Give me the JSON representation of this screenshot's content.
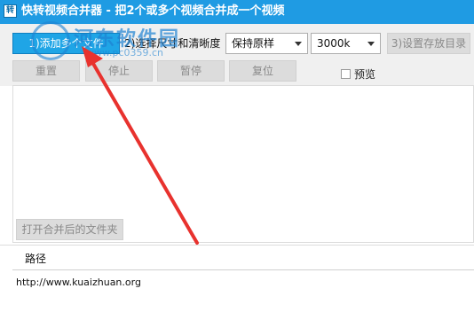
{
  "window": {
    "title": "快转视频合并器 - 把2个或多个视频合并成一个视频",
    "icon": "app-icon"
  },
  "toolbar": {
    "add_files_label": "1)添加多个文件",
    "step2_label": "2)选择尺寸和清晰度",
    "size_select_value": "保持原样",
    "quality_select_value": "3000k",
    "set_output_label": "3)设置存放目录",
    "reset_label": "重置",
    "stop_label": "停止",
    "pause_label": "暂停",
    "resume_label": "复位",
    "preview_label": "预览",
    "preview_checked": false
  },
  "main": {
    "open_folder_label": "打开合并后的文件夹",
    "path_header": "路径",
    "url": "http://www.kuaizhuan.org"
  },
  "watermark": {
    "text": "河东软件园",
    "sub": "www.pc0359.cn"
  },
  "annotation": {
    "arrow_color": "#e8322e"
  },
  "colors": {
    "titlebar": "#1f9be3",
    "primary_button": "#1fa5e6"
  }
}
